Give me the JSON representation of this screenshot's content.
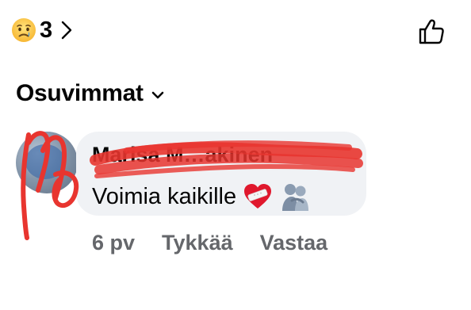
{
  "reactions": {
    "emoji": "sad-face",
    "count": "3"
  },
  "sort": {
    "label": "Osuvimmat"
  },
  "comment": {
    "author": "Marisa M…akinen",
    "text": "Voimia kaikille",
    "emojis": [
      "heart-with-bandage",
      "people-hugging"
    ],
    "timestamp": "6 pv",
    "like_label": "Tykkää",
    "reply_label": "Vastaa"
  },
  "colors": {
    "background": "#ffffff",
    "bubble": "#f0f2f5",
    "text_primary": "#050505",
    "text_secondary": "#65676b",
    "redaction_marker": "#e8352f"
  }
}
